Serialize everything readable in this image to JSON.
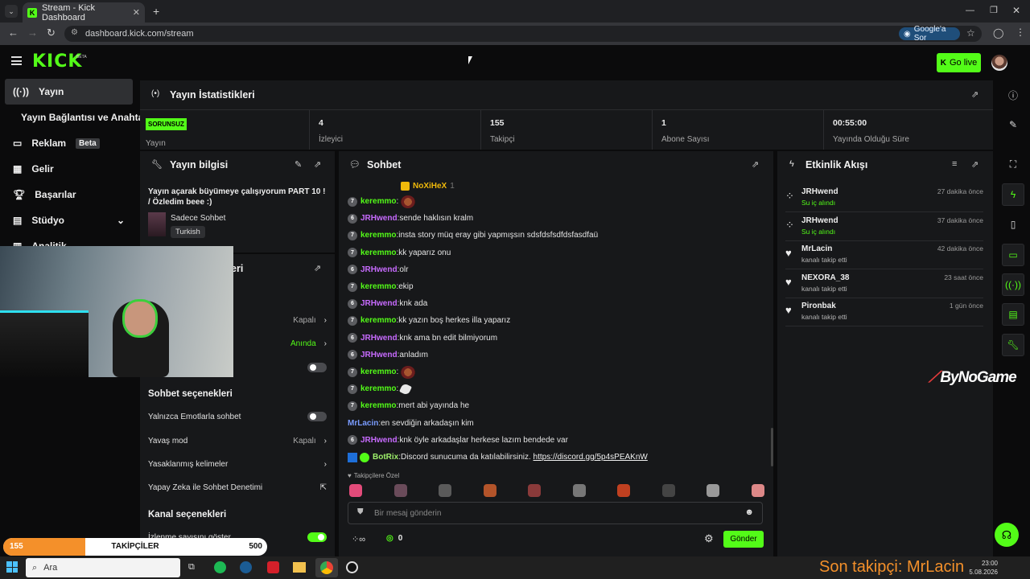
{
  "browser": {
    "tab_title": "Stream - Kick Dashboard",
    "url": "dashboard.kick.com/stream",
    "google_ask": "Google'a Sor"
  },
  "topnav": {
    "logo": "KICK",
    "logo_sup": "BETA",
    "go_live": "Go live"
  },
  "sidebar": {
    "items": [
      {
        "label": "Yayın",
        "icon": "broadcast-icon"
      },
      {
        "label": "Yayın Bağlantısı ve Anahtarı",
        "icon": ""
      },
      {
        "label": "Reklam",
        "badge": "Beta",
        "icon": "ad-icon"
      },
      {
        "label": "Gelir",
        "icon": "chart-icon"
      },
      {
        "label": "Başarılar",
        "icon": "trophy-icon"
      },
      {
        "label": "Stüdyo",
        "icon": "studio-icon"
      },
      {
        "label": "Analitik",
        "icon": "analytics-icon"
      }
    ]
  },
  "stats": {
    "title": "Yayın İstatistikleri",
    "status_badge": "SORUNSUZ",
    "cells": [
      {
        "value": "",
        "label": "Yayın"
      },
      {
        "value": "4",
        "label": "İzleyici"
      },
      {
        "value": "155",
        "label": "Takipçi"
      },
      {
        "value": "1",
        "label": "Abone Sayısı"
      },
      {
        "value": "00:55:00",
        "label": "Yayında Olduğu Süre"
      }
    ]
  },
  "stream_info": {
    "title": "Yayın bilgisi",
    "stream_title": "Yayın açarak büyümeye çalışıyorum PART 10 ! / Özledim beee :)",
    "category": "Sadece Sohbet",
    "tag": "Turkish"
  },
  "settings_panel": {
    "title_fragment": "eri",
    "rows": [
      {
        "label": "",
        "value": "Kapalı"
      },
      {
        "label": "",
        "value": "Anında"
      }
    ],
    "chat_options_title": "Sohbet seçenekleri",
    "chat_options": [
      {
        "label": "Yalnızca Emotlarla sohbet",
        "value": ""
      },
      {
        "label": "Yavaş mod",
        "value": "Kapalı"
      },
      {
        "label": "Yasaklanmış kelimeler",
        "value": ""
      },
      {
        "label": "Yapay Zeka ile Sohbet Denetimi",
        "value": ""
      }
    ],
    "channel_options_title": "Kanal seçenekleri",
    "channel_options": [
      {
        "label": "İzlenme sayısını göster"
      }
    ]
  },
  "chat": {
    "title": "Sohbet",
    "pinned_user": "NoXiHeX",
    "pinned_count": "1",
    "messages": [
      {
        "badge": "7",
        "user": "keremmo",
        "color": "green",
        "text": "",
        "emote": "emote"
      },
      {
        "badge": "6",
        "user": "JRHwend",
        "color": "purple",
        "text": "sende haklısın kralm"
      },
      {
        "badge": "7",
        "user": "keremmo",
        "color": "green",
        "text": "insta story müq eray gibi yapmışsın sdsfdsfsdfdsfasdfaü"
      },
      {
        "badge": "7",
        "user": "keremmo",
        "color": "green",
        "text": "kk yaparız onu"
      },
      {
        "badge": "6",
        "user": "JRHwend",
        "color": "purple",
        "text": "olr"
      },
      {
        "badge": "7",
        "user": "keremmo",
        "color": "green",
        "text": "ekip"
      },
      {
        "badge": "6",
        "user": "JRHwend",
        "color": "purple",
        "text": "knk ada"
      },
      {
        "badge": "7",
        "user": "keremmo",
        "color": "green",
        "text": "kk yazın boş herkes illa yaparız"
      },
      {
        "badge": "6",
        "user": "JRHwend",
        "color": "purple",
        "text": "knk ama bn edit bilmiyorum"
      },
      {
        "badge": "6",
        "user": "JRHwend",
        "color": "purple",
        "text": "anladım"
      },
      {
        "badge": "7",
        "user": "keremmo",
        "color": "green",
        "text": "",
        "emote": "emote"
      },
      {
        "badge": "7",
        "user": "keremmo",
        "color": "green",
        "text": "",
        "emote": "feather"
      },
      {
        "badge": "7",
        "user": "keremmo",
        "color": "green",
        "text": "mert abi yayında he"
      },
      {
        "badge": "",
        "user": "MrLacin",
        "color": "blue",
        "text": "en sevdiğin arkadaşın kim"
      },
      {
        "badge": "6",
        "user": "JRHwend",
        "color": "purple",
        "text": "knk öyle arkadaşlar herkese lazım bendede var"
      },
      {
        "badge": "bot",
        "user": "BotRix",
        "color": "lime",
        "text": "Discord sunucuma da katılabilirsiniz. ",
        "link": "https://discord.gg/5p4sPEAKnW"
      }
    ],
    "followers_only_label": "Takipçilere Özel",
    "input_placeholder": "Bir mesaj gönderin",
    "points": "0",
    "send_button": "Gönder"
  },
  "activity": {
    "title": "Etkinlik Akışı",
    "events": [
      {
        "name": "JRHwend",
        "sub": "Su iç alındı",
        "time": "27 dakika önce",
        "icon": "drops-icon",
        "green": true
      },
      {
        "name": "JRHwend",
        "sub": "Su iç alındı",
        "time": "37 dakika önce",
        "icon": "drops-icon",
        "green": true
      },
      {
        "name": "MrLacin",
        "sub": "kanalı takip etti",
        "time": "42 dakika önce",
        "icon": "heart-icon",
        "green": false
      },
      {
        "name": "NEXORA_38",
        "sub": "kanalı takip etti",
        "time": "23 saat önce",
        "icon": "heart-icon",
        "green": false
      },
      {
        "name": "Pironbak",
        "sub": "kanalı takip etti",
        "time": "1 gün önce",
        "icon": "heart-icon",
        "green": false
      }
    ]
  },
  "overlay": {
    "brand": "ByNoGame",
    "follower_goal": {
      "current": "155",
      "label": "TAKİPÇİLER",
      "target": "500",
      "fill_fraction": 0.31
    },
    "last_follower": "Son takipçi: MrLacin"
  },
  "taskbar": {
    "search": "Ara",
    "time": "23:00",
    "date": "5.08.2026"
  },
  "colors": {
    "accent": "#53fc18",
    "panel": "#17181a",
    "bg": "#0b0b0c",
    "purple": "#c86bff",
    "goal_fill": "#f4902a"
  }
}
